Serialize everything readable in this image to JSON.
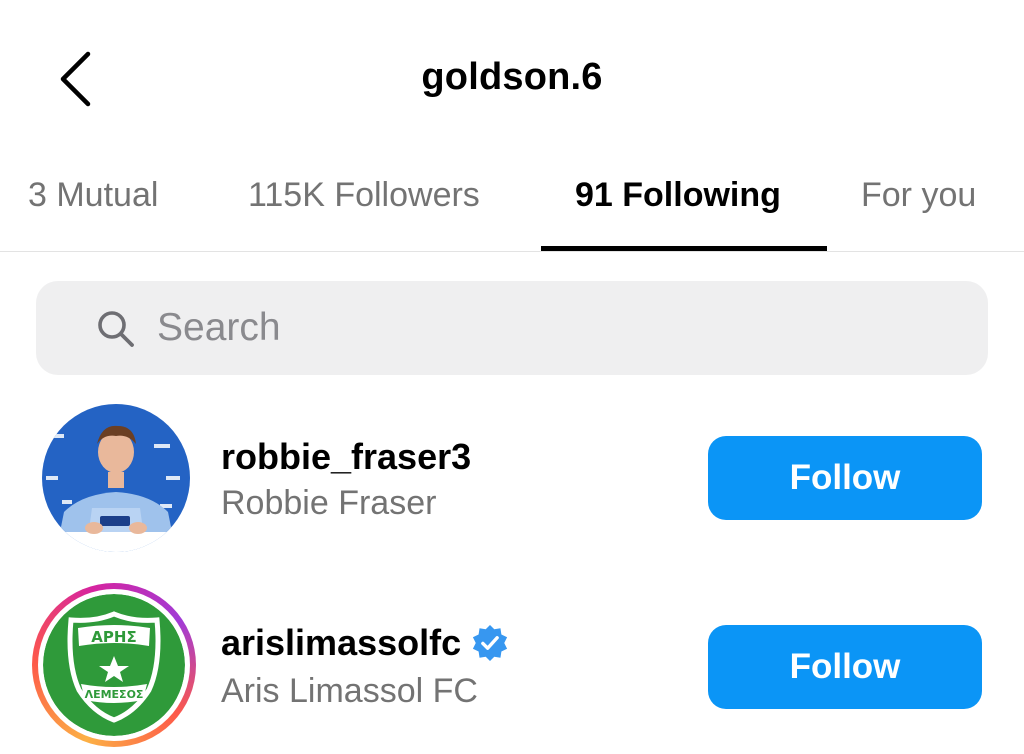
{
  "header": {
    "title": "goldson.6",
    "back_icon": "chevron-left-icon"
  },
  "tabs": [
    {
      "label": "3 Mutual",
      "active": false
    },
    {
      "label": "115K Followers",
      "active": false
    },
    {
      "label": "91 Following",
      "active": true
    },
    {
      "label": "For you",
      "active": false
    }
  ],
  "search": {
    "placeholder": "Search",
    "value": "",
    "icon": "search-icon"
  },
  "accounts": [
    {
      "username": "robbie_fraser3",
      "full_name": "Robbie Fraser",
      "verified": false,
      "has_story_ring": false,
      "button_label": "Follow"
    },
    {
      "username": "arislimassolfc",
      "full_name": "Aris Limassol FC",
      "verified": true,
      "has_story_ring": true,
      "button_label": "Follow",
      "logo": {
        "top": "ΑΡΗΣ",
        "bottom": "ΛΕΜΕΣΟΣ"
      }
    }
  ],
  "colors": {
    "accent": "#0b95f6",
    "secondary_text": "#737373",
    "search_bg": "#efeff0",
    "logo_green": "#2f9a3a"
  }
}
